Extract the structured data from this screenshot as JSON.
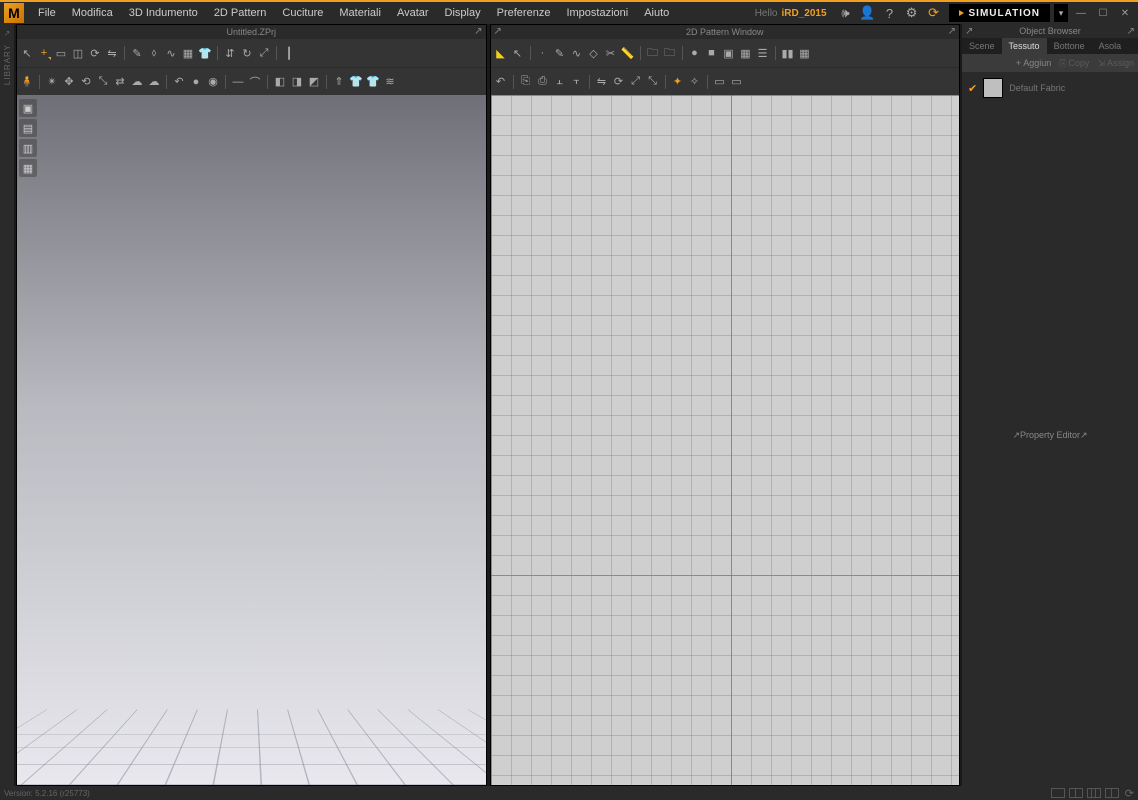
{
  "menu": {
    "items": [
      "File",
      "Modifica",
      "3D Indumento",
      "2D Pattern",
      "Cuciture",
      "Materiali",
      "Avatar",
      "Display",
      "Preferenze",
      "Impostazioni",
      "Aiuto"
    ],
    "hello": "Hello",
    "user": "iRD_2015",
    "simulation_label": "SIMULATION"
  },
  "left_strip": {
    "label": "LIBRARY"
  },
  "panel3d": {
    "title": "Untitled.ZPrj",
    "toolbar1": [
      "cursor",
      "plus",
      "marquee",
      "rect",
      "rotate",
      "mirror",
      "pen",
      "anchor",
      "smooth",
      "grid",
      "garment",
      "sym",
      "rotate2",
      "scale",
      "divider"
    ],
    "toolbar2": [
      "avatar",
      "pose",
      "translate",
      "rotate",
      "scale",
      "flip",
      "cloud",
      "cloud2",
      "undo",
      "sphere",
      "sphere2",
      "divider",
      "tool1",
      "tool2",
      "tool3",
      "tool4",
      "float",
      "garment2",
      "garment3",
      "wind"
    ],
    "side": [
      "front",
      "side",
      "persp",
      "top"
    ]
  },
  "panel2d": {
    "title": "2D Pattern Window",
    "toolbar1": [
      "select",
      "edit",
      "point",
      "pen",
      "curve",
      "shape",
      "knife",
      "measure",
      "folder",
      "folder2",
      "divider",
      "circle",
      "square",
      "square2",
      "square3",
      "layer",
      "divider",
      "bars",
      "grid2"
    ],
    "toolbar2": [
      "undo",
      "copy",
      "paste",
      "align",
      "align2",
      "divider",
      "mirror",
      "rotate",
      "scale",
      "scale2",
      "divider",
      "snap",
      "snap2",
      "divider",
      "t1",
      "t2"
    ]
  },
  "object_browser": {
    "title": "Object Browser",
    "tabs": [
      "Scene",
      "Tessuto",
      "Bottone",
      "Asola"
    ],
    "active_tab": 1,
    "actions": {
      "add": "Aggiun",
      "copy": "Copy",
      "assign": "Assign"
    },
    "items": [
      {
        "checked": true,
        "name": "Default Fabric"
      }
    ]
  },
  "property_editor": {
    "title": "Property Editor"
  },
  "status": {
    "version": "Version: 5.2.16 (r25773)"
  }
}
